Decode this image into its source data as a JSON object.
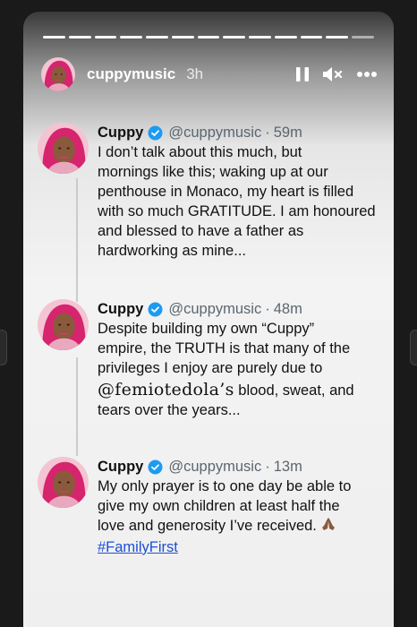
{
  "story": {
    "username": "cuppymusic",
    "age": "3h",
    "progress_segments": 13,
    "progress_active": 12
  },
  "controls": {
    "pause_icon": "pause-icon",
    "mute_icon": "muted-speaker-icon",
    "more_icon": "more-horizontal-icon"
  },
  "tweets": [
    {
      "name": "Cuppy",
      "handle": "@cuppymusic",
      "dot": "·",
      "time": "59m",
      "lines": [
        "I don’t talk about this much, but",
        "mornings like this; waking up at our",
        "penthouse in Monaco, my heart is filled",
        "with so much GRATITUDE. I am honoured",
        "and blessed to have a father as",
        "hardworking as mine..."
      ]
    },
    {
      "name": "Cuppy",
      "handle": "@cuppymusic",
      "dot": "·",
      "time": "48m",
      "lines": [
        "Despite building my own “Cuppy”",
        "empire, the TRUTH is that many of the",
        "privileges I enjoy are purely due to"
      ],
      "mention": "@femiotedola’s",
      "after_mention": " blood, sweat, and",
      "last_line": "tears over the years..."
    },
    {
      "name": "Cuppy",
      "handle": "@cuppymusic",
      "dot": "·",
      "time": "13m",
      "lines": [
        "My only prayer is to one day be able to",
        "give my own children at least half the"
      ],
      "line3": "love and generosity I’ve received. ",
      "hashtag": "#FamilyFirst"
    }
  ],
  "colors": {
    "verified": "#1d9bf0",
    "link": "#1d4ed8",
    "hair": "#d6246e"
  }
}
